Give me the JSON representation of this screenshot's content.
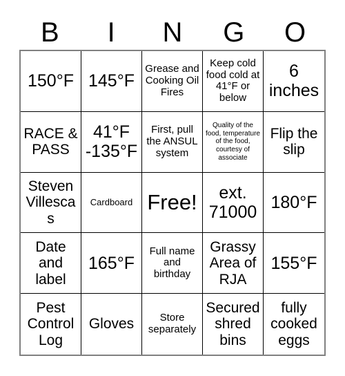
{
  "card": {
    "title": "BINGO Card",
    "header": {
      "letters": [
        "B",
        "I",
        "N",
        "G",
        "O"
      ]
    },
    "free_space_index": 12,
    "cells": [
      {
        "text": "150°F",
        "size": "size-lg"
      },
      {
        "text": "145°F",
        "size": "size-lg"
      },
      {
        "text": "Grease and Cooking Oil Fires",
        "size": "size-sm"
      },
      {
        "text": "Keep cold food cold at 41°F or below",
        "size": "size-sm"
      },
      {
        "text": "6 inches",
        "size": "size-lg"
      },
      {
        "text": "RACE & PASS",
        "size": "size-md"
      },
      {
        "text": "41°F -135°F",
        "size": "size-lg"
      },
      {
        "text": "First, pull the ANSUL system",
        "size": "size-sm"
      },
      {
        "text": "Quality of the food, temperature of the food, courtesy of associate",
        "size": "size-xxs"
      },
      {
        "text": "Flip the slip",
        "size": "size-md"
      },
      {
        "text": "Steven Villescas",
        "size": "size-md"
      },
      {
        "text": "Cardboard",
        "size": "size-xs"
      },
      {
        "text": "Free!",
        "size": "size-xl"
      },
      {
        "text": "ext. 71000",
        "size": "size-lg"
      },
      {
        "text": "180°F",
        "size": "size-lg"
      },
      {
        "text": "Date and label",
        "size": "size-md"
      },
      {
        "text": "165°F",
        "size": "size-lg"
      },
      {
        "text": "Full name and birthday",
        "size": "size-sm"
      },
      {
        "text": "Grassy Area of RJA",
        "size": "size-md"
      },
      {
        "text": "155°F",
        "size": "size-lg"
      },
      {
        "text": "Pest Control Log",
        "size": "size-md"
      },
      {
        "text": "Gloves",
        "size": "size-md"
      },
      {
        "text": "Store separately",
        "size": "size-sm"
      },
      {
        "text": "Secured shred bins",
        "size": "size-md"
      },
      {
        "text": "fully cooked eggs",
        "size": "size-md"
      }
    ],
    "colors": {
      "background": "#ffffff",
      "text": "#000000",
      "inner_border": "#000000",
      "outer_border": "#808080"
    }
  }
}
